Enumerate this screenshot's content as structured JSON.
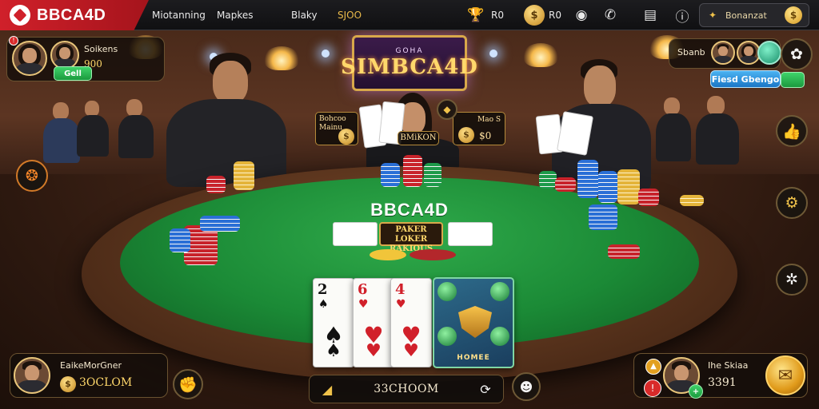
{
  "topbar": {
    "brand": "BBCA4D",
    "nav": [
      "Miotanning",
      "Mapkes",
      "Blaky"
    ],
    "gold_nav": "SJOO",
    "icons": [
      "trophy-icon",
      "notes-icon",
      "coin-icon",
      "settings-icon",
      "phone-icon",
      "book-icon",
      "info-icon"
    ],
    "count_text": "R0",
    "pill_label": "Bonanzat"
  },
  "sign": {
    "title": "SIMBCA4D",
    "sub": "GOHA"
  },
  "top_left": {
    "name": "Soikens",
    "amount": "900",
    "button": "Gell"
  },
  "top_right": {
    "name": "Sbanb",
    "button": "Fiesd Gbengo"
  },
  "plates": {
    "left": {
      "line1": "Bohcoo",
      "line2": "Mainu"
    },
    "center": "BMiKON",
    "right": {
      "line1": "Mao S",
      "line2": "$0"
    }
  },
  "felt": {
    "logo": "BBCA4D",
    "plate": [
      "PAKER",
      "LOKER",
      "RAKIOUS"
    ]
  },
  "hand": [
    {
      "rank": "2",
      "suit": "♠",
      "color": "black"
    },
    {
      "rank": "6",
      "suit": "♥",
      "color": "red"
    },
    {
      "rank": "4",
      "suit": "♥",
      "color": "red"
    }
  ],
  "special_card": {
    "label": "HOMEE"
  },
  "bottom_left": {
    "name": "EaikeMorGner",
    "amount": "3OCLOM"
  },
  "bottom_center": {
    "text": "33CHOOM"
  },
  "bottom_right": {
    "name": "Ihe Skiaa",
    "amount": "3391"
  },
  "colors": {
    "brand": "#d0202a",
    "felt": "#1b8a36",
    "gold": "#f0c24a"
  }
}
